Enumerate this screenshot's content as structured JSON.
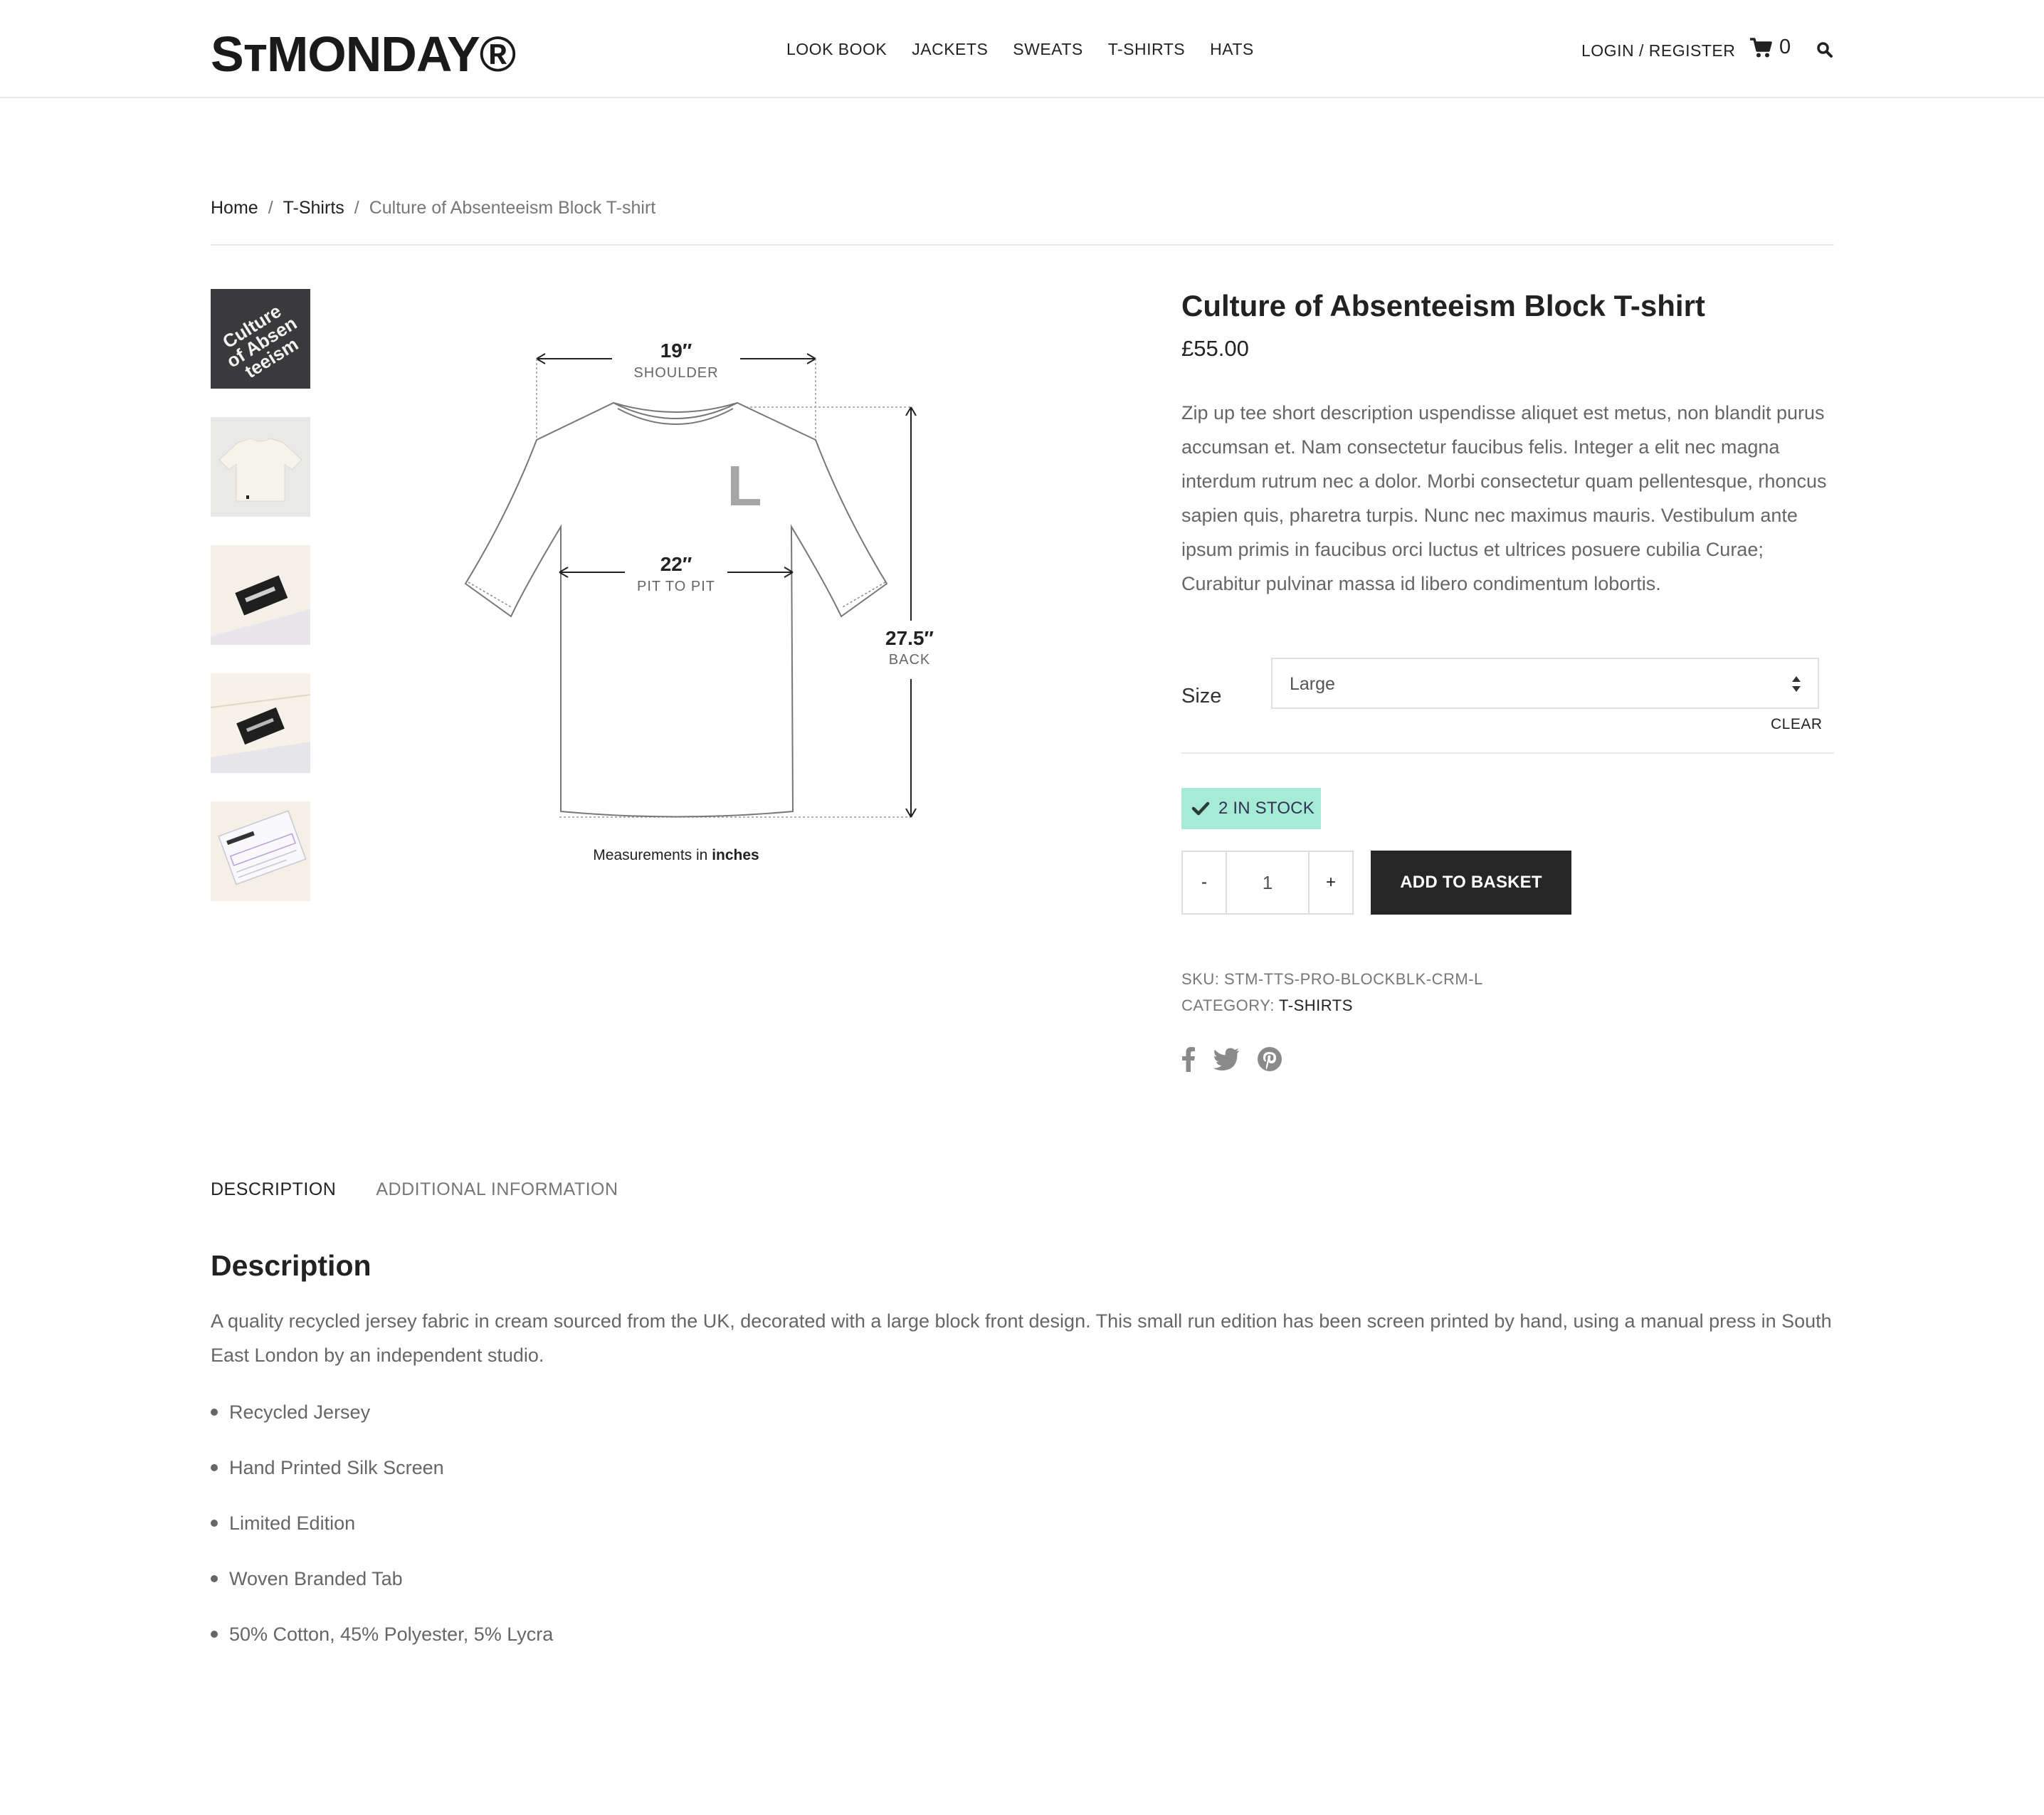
{
  "brand": {
    "logo_text": "SᴛMONDAY®"
  },
  "nav": {
    "items": [
      "LOOK BOOK",
      "JACKETS",
      "SWEATS",
      "T-SHIRTS",
      "HATS"
    ],
    "login_label": "LOGIN / REGISTER",
    "cart_count": "0"
  },
  "breadcrumb": {
    "home": "Home",
    "category": "T-Shirts",
    "current": "Culture of Absenteeism Block T-shirt"
  },
  "gallery": {
    "thumb1_text": [
      "Culture",
      "of Absen",
      "teeism"
    ],
    "chart": {
      "shoulder_value": "19″",
      "shoulder_label": "SHOULDER",
      "pit_value": "22″",
      "pit_label": "PIT TO PIT",
      "back_value": "27.5″",
      "back_label": "BACK",
      "size_letter": "L",
      "caption_prefix": "Measurements in ",
      "caption_unit": "inches"
    }
  },
  "product": {
    "title": "Culture of Absenteeism Block T-shirt",
    "price": "£55.00",
    "short_description": "Zip up tee short description uspendisse aliquet est metus, non blandit purus accumsan et. Nam consectetur faucibus felis. Integer a elit nec magna interdum rutrum nec a dolor. Morbi consectetur quam pellentesque, rhoncus sapien quis, pharetra turpis. Nunc nec maximus mauris. Vestibulum ante ipsum primis in faucibus orci luctus et ultrices posuere cubilia Curae; Curabitur pulvinar massa id libero condimentum lobortis.",
    "size_label": "Size",
    "size_value": "Large",
    "clear_label": "CLEAR",
    "stock_text": "2 IN STOCK",
    "qty_minus": "-",
    "qty_value": "1",
    "qty_plus": "+",
    "add_to_basket": "ADD TO BASKET",
    "sku_label": "SKU:",
    "sku_value": "STM-TTS-PRO-BLOCKBLK-CRM-L",
    "category_label": "CATEGORY:",
    "category_value": "T-SHIRTS"
  },
  "tabs": {
    "description": "DESCRIPTION",
    "additional": "ADDITIONAL INFORMATION"
  },
  "description": {
    "heading": "Description",
    "body": "A quality recycled jersey fabric in cream sourced from the UK, decorated with a large block front design. This small run edition has been screen printed by hand, using a manual press in South East London by an independent studio.",
    "features": [
      "Recycled Jersey",
      "Hand Printed Silk Screen",
      "Limited Edition",
      "Woven Branded Tab",
      "50% Cotton, 45% Polyester, 5% Lycra"
    ]
  },
  "colors": {
    "accent_stock": "#a6ebd6",
    "button_dark": "#262626",
    "text_muted": "#666666"
  }
}
